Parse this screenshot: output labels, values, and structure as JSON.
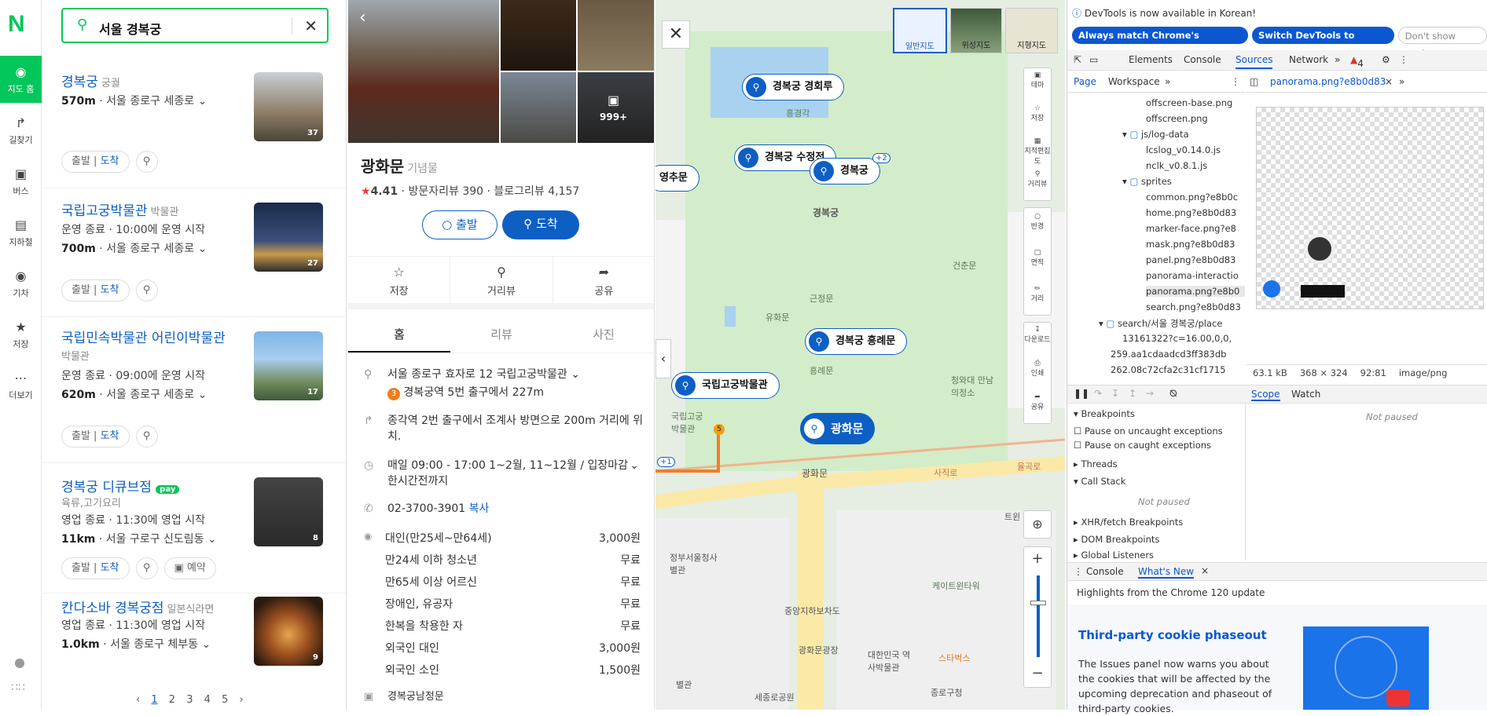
{
  "rail": {
    "logo": "N",
    "items": [
      "지도 홈",
      "길찾기",
      "버스",
      "지하철",
      "기차",
      "저장",
      "더보기"
    ]
  },
  "search": {
    "query": "서울 경복궁"
  },
  "results": [
    {
      "name": "경복궁",
      "category": "궁궐",
      "status": "",
      "distance": "570m",
      "address": "서울 종로구 세종로",
      "photos": "37"
    },
    {
      "name": "국립고궁박물관",
      "category": "박물관",
      "status": "운영 종료 · 10:00에 운영 시작",
      "distance": "700m",
      "address": "서울 종로구 세종로",
      "photos": "27"
    },
    {
      "name": "국립민속박물관 어린이박물관",
      "category": "박물관",
      "status": "운영 종료 · 09:00에 운영 시작",
      "distance": "620m",
      "address": "서울 종로구 세종로",
      "photos": "17"
    },
    {
      "name": "경복궁 디큐브점",
      "category": "육류,고기요리",
      "badge": "pay",
      "status": "영업 종료 · 11:30에 영업 시작",
      "distance": "11km",
      "address": "서울 구로구 신도림동",
      "photos": "8"
    },
    {
      "name": "칸다소바 경복궁점",
      "category": "일본식라면",
      "status": "영업 종료 · 11:30에 영업 시작",
      "distance": "1.0km",
      "address": "서울 종로구 체부동",
      "photos": "9"
    }
  ],
  "list_actions": {
    "depart": "출발",
    "arrive": "도착",
    "reserve": "예약"
  },
  "pager": [
    "1",
    "2",
    "3",
    "4",
    "5"
  ],
  "detail": {
    "title": "광화문",
    "category": "기념물",
    "rating": "4.41",
    "visitor_reviews": "방문자리뷰 390",
    "blog_reviews": "블로그리뷰 4,157",
    "photo_count": "999+",
    "btn_depart": "출발",
    "btn_arrive": "도착",
    "actions": [
      "저장",
      "거리뷰",
      "공유"
    ],
    "tabs": [
      "홈",
      "리뷰",
      "사진"
    ],
    "address": "서울 종로구 효자로 12 국립고궁박물관",
    "subway": "경복궁역 5번 출구에서 227m",
    "subway_line": "3",
    "directions": "종각역 2번 출구에서 조계사 방면으로 200m 거리에 위치.",
    "hours": "매일 09:00 - 17:00 1~2월, 11~12월 / 입장마감 한시간전까지",
    "phone": "02-3700-3901",
    "copy": "복사",
    "prices": [
      {
        "label": "대인(만25세~만64세)",
        "value": "3,000원"
      },
      {
        "label": "만24세 이하 청소년",
        "value": "무료"
      },
      {
        "label": "만65세 이상 어르신",
        "value": "무료"
      },
      {
        "label": "장애인, 유공자",
        "value": "무료"
      },
      {
        "label": "한복을 착용한 자",
        "value": "무료"
      },
      {
        "label": "외국인 대인",
        "value": "3,000원"
      },
      {
        "label": "외국인 소인",
        "value": "1,500원"
      }
    ],
    "parking": "경복궁남정문"
  },
  "map": {
    "types": [
      "일반지도",
      "위성지도",
      "지형지도"
    ],
    "markers": [
      "경복궁 경회루",
      "경복궁 수정전",
      "경복궁",
      "경복궁 흥례문",
      "국립고궁박물관",
      "광화문",
      "영추문"
    ],
    "plus_badge": "+2",
    "labels": [
      "흥경각",
      "경복궁",
      "근정문",
      "유화문",
      "흥례문",
      "국립고궁박물관",
      "광화문",
      "건춘문",
      "청와대 만남의정소",
      "정부서울청사 별관",
      "케이트윈타워",
      "중앙지하보차도",
      "광화문광장",
      "대한민국 역사박물관",
      "스타벅스",
      "종로구청",
      "세종로공원",
      "별관",
      "사직로",
      "율곡로",
      "트윈",
      "+1"
    ],
    "tools": [
      "테마",
      "저장",
      "지적편집도",
      "거리뷰",
      "반경",
      "면적",
      "거리",
      "다운로드",
      "인쇄",
      "공유"
    ]
  },
  "devtools": {
    "notice": "DevTools is now available in Korean!",
    "btn1": "Always match Chrome's language",
    "btn2": "Switch DevTools to Korean",
    "btn3": "Don't show again",
    "tabs": [
      "Elements",
      "Console",
      "Sources",
      "Network"
    ],
    "issues": "4",
    "subtabs": [
      "Page",
      "Workspace"
    ],
    "file_tab": "panorama.png?e8b0d83",
    "files": [
      "offscreen-base.png",
      "offscreen.png",
      "js/log-data",
      "lcslog_v0.14.0.js",
      "nclk_v0.8.1.js",
      "sprites",
      "common.png?e8b0c",
      "home.png?e8b0d83",
      "marker-face.png?e8",
      "mask.png?e8b0d83",
      "panel.png?e8b0d83",
      "panorama-interactio",
      "panorama.png?e8b0",
      "search.png?e8b0d83",
      "search/서울 경복궁/place",
      "13161322?c=16.00,0,0,",
      "259.aa1cdaadcd3ff383db",
      "262.08c72cfa2c31cf1715"
    ],
    "image_info": {
      "size": "63.1 kB",
      "dims": "368 × 324",
      "pos": "92:81",
      "type": "image/png"
    },
    "scope_tabs": [
      "Scope",
      "Watch"
    ],
    "not_paused": "Not paused",
    "breakpoints": "Breakpoints",
    "pause_uncaught": "Pause on uncaught exceptions",
    "pause_caught": "Pause on caught exceptions",
    "threads": "Threads",
    "call_stack": "Call Stack",
    "xhr": "XHR/fetch Breakpoints",
    "dom": "DOM Breakpoints",
    "global": "Global Listeners",
    "drawer_tabs": [
      "Console",
      "What's New"
    ],
    "highlights": "Highlights from the Chrome 120 update",
    "article_title": "Third-party cookie phaseout",
    "article_body": "The Issues panel now warns you about the cookies that will be affected by the upcoming deprecation and phaseout of third-party cookies."
  }
}
